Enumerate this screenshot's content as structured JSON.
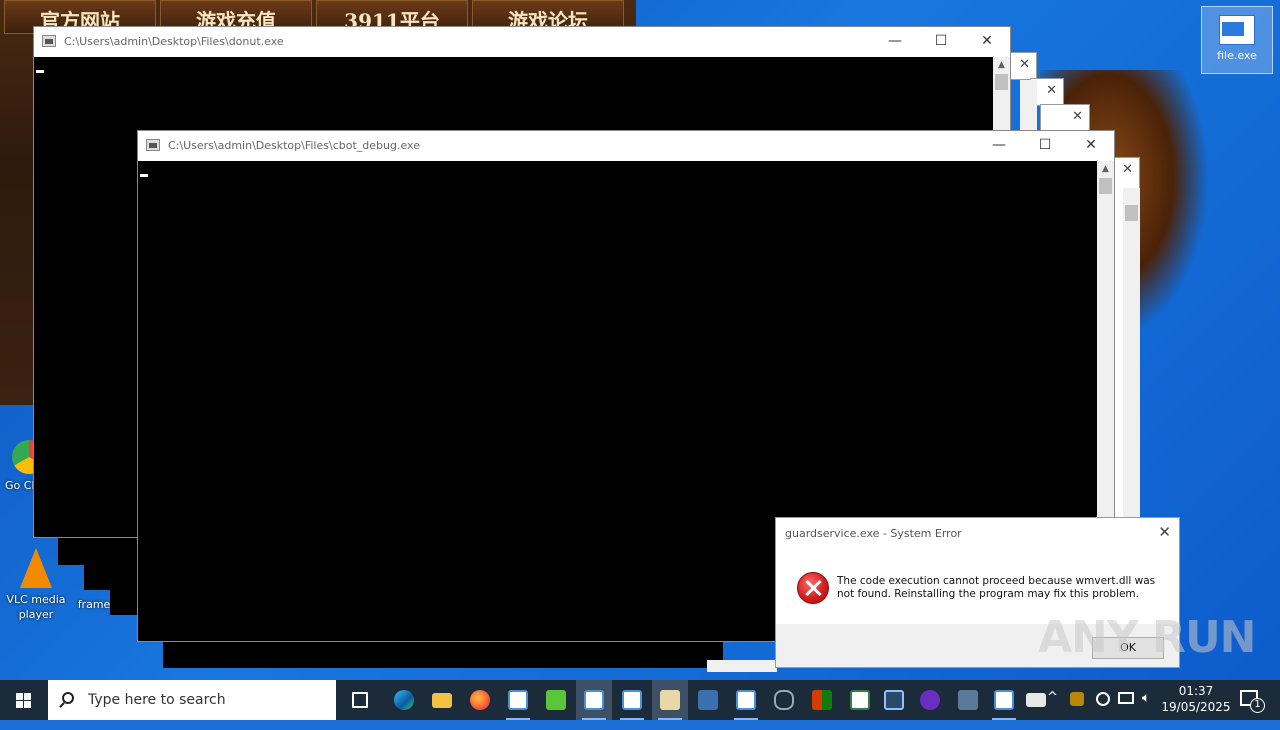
{
  "banner": {
    "nav": [
      "官方网站",
      "游戏充值",
      "3911平台",
      "游戏论坛"
    ]
  },
  "desktop_icons": {
    "chrome": "Go Chr",
    "vlc": "VLC media player",
    "frame": "frame",
    "file": "file.exe"
  },
  "windows": {
    "donut": {
      "title": "C:\\Users\\admin\\Desktop\\Files\\donut.exe"
    },
    "cbot": {
      "title": "C:\\Users\\admin\\Desktop\\Files\\cbot_debug.exe"
    }
  },
  "controls": {
    "minimize": "—",
    "maximize": "☐",
    "close": "✕"
  },
  "dialog": {
    "title": "guardservice.exe - System Error",
    "message": "The code execution cannot proceed because wmvert.dll was not found. Reinstalling the program may fix this problem.",
    "ok": "OK"
  },
  "watermark": "ANY RUN",
  "taskbar": {
    "search_placeholder": "Type here to search",
    "time": "01:37",
    "date": "19/05/2025",
    "notification_count": "1"
  },
  "colors": {
    "taskbar": "#1c2b3a",
    "desktop": "#1877de",
    "error_red": "#d21f1f"
  }
}
